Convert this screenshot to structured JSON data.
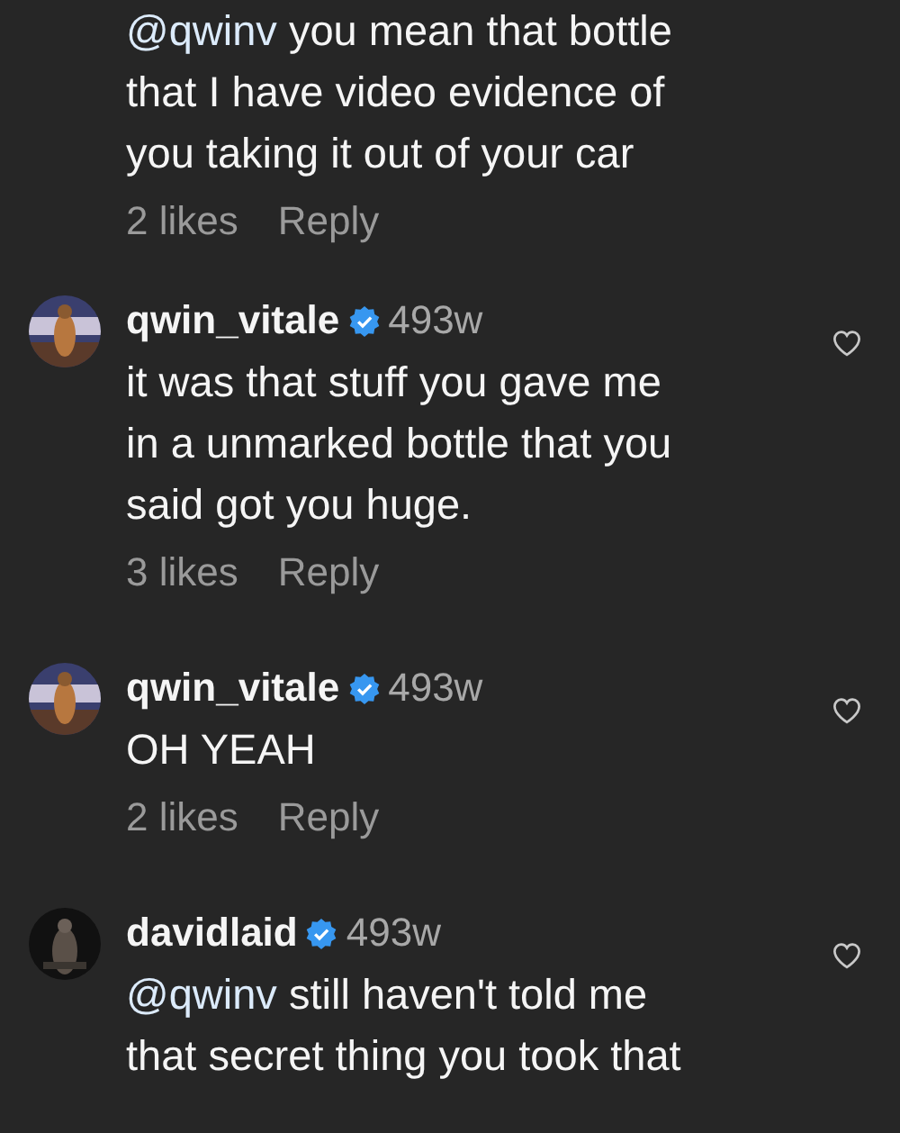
{
  "comments": [
    {
      "mention": "@qwinv",
      "lines": [
        " you mean that bottle",
        "that I have video evidence of",
        "you taking it out of your car"
      ],
      "likes": "2 likes",
      "reply": "Reply"
    },
    {
      "username": "qwin_vitale",
      "verified": true,
      "time": "493w",
      "liked": false,
      "lines": [
        "it was that stuff you gave me",
        "in a unmarked bottle that you",
        "said got you huge."
      ],
      "likes": "3 likes",
      "reply": "Reply"
    },
    {
      "username": "qwin_vitale",
      "verified": true,
      "time": "493w",
      "liked": false,
      "lines": [
        "OH YEAH"
      ],
      "likes": "2 likes",
      "reply": "Reply"
    },
    {
      "username": "davidlaid",
      "verified": true,
      "time": "493w",
      "liked": false,
      "mention": "@qwinv",
      "lines": [
        " still haven't told me",
        "that secret thing you took that"
      ]
    }
  ]
}
